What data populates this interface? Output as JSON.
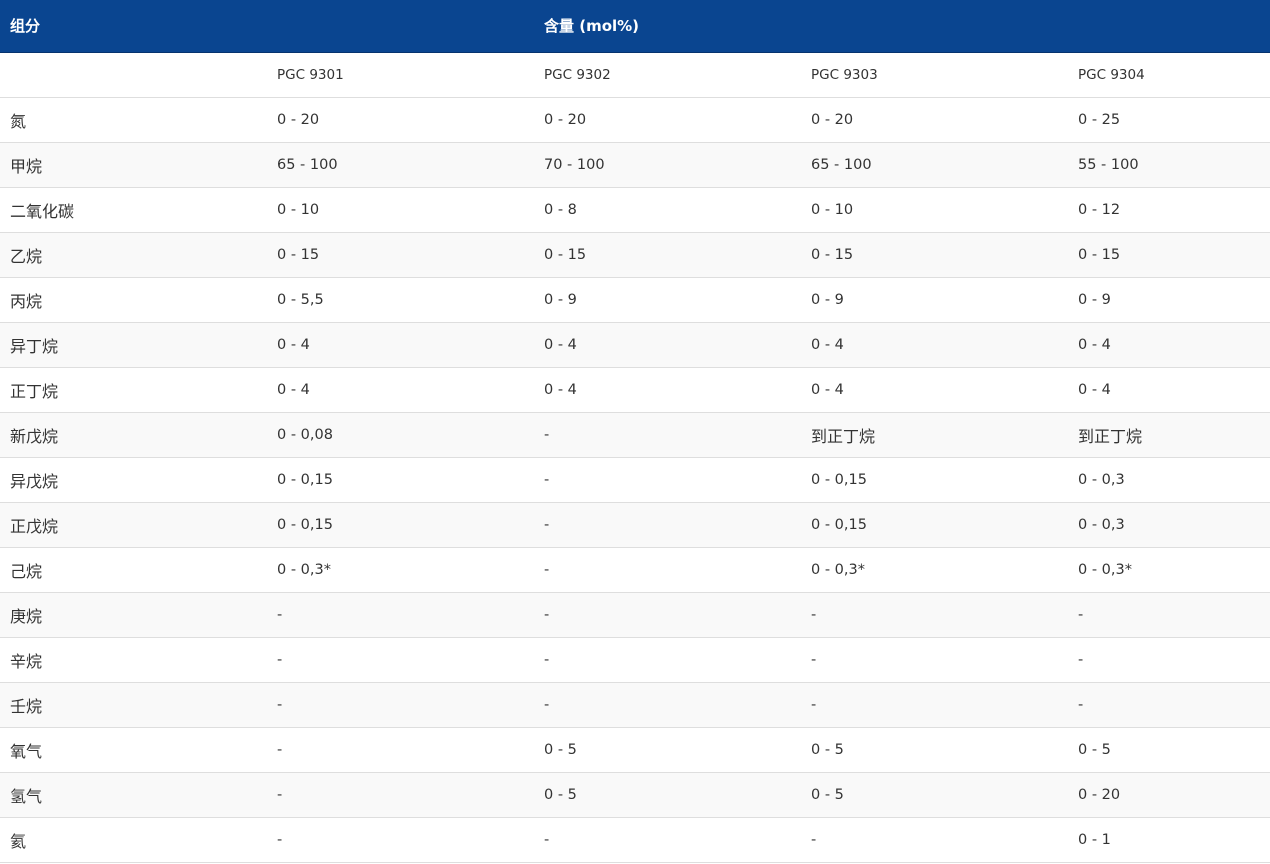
{
  "table": {
    "header": {
      "component_label": "组分",
      "content_label": "含量 (mol%)"
    },
    "models": [
      "PGC 9301",
      "PGC 9302",
      "PGC 9303",
      "PGC 9304"
    ],
    "rows": [
      {
        "component": "氮",
        "values": [
          "0 - 20",
          "0 - 20",
          "0 - 20",
          "0 - 25"
        ]
      },
      {
        "component": "甲烷",
        "values": [
          "65 - 100",
          "70 - 100",
          "65 - 100",
          "55 - 100"
        ]
      },
      {
        "component": "二氧化碳",
        "values": [
          "0 - 10",
          "0 - 8",
          "0 - 10",
          "0 - 12"
        ]
      },
      {
        "component": "乙烷",
        "values": [
          "0 - 15",
          "0 - 15",
          "0 - 15",
          "0 - 15"
        ]
      },
      {
        "component": "丙烷",
        "values": [
          "0 - 5,5",
          "0 - 9",
          "0 - 9",
          "0 - 9"
        ]
      },
      {
        "component": "异丁烷",
        "values": [
          "0 - 4",
          "0 - 4",
          "0 - 4",
          "0 - 4"
        ]
      },
      {
        "component": "正丁烷",
        "values": [
          "0 - 4",
          "0 - 4",
          "0 - 4",
          "0 - 4"
        ]
      },
      {
        "component": "新戊烷",
        "values": [
          "0 - 0,08",
          "-",
          "到正丁烷",
          "到正丁烷"
        ]
      },
      {
        "component": "异戊烷",
        "values": [
          "0 - 0,15",
          "-",
          "0 - 0,15",
          "0 - 0,3"
        ]
      },
      {
        "component": "正戊烷",
        "values": [
          "0 - 0,15",
          "-",
          "0 - 0,15",
          "0 - 0,3"
        ]
      },
      {
        "component": "己烷",
        "values": [
          "0 - 0,3*",
          "-",
          "0 - 0,3*",
          "0 - 0,3*"
        ]
      },
      {
        "component": "庚烷",
        "values": [
          "-",
          "-",
          "-",
          "-"
        ]
      },
      {
        "component": "辛烷",
        "values": [
          "-",
          "-",
          "-",
          "-"
        ]
      },
      {
        "component": "壬烷",
        "values": [
          "-",
          "-",
          "-",
          "-"
        ]
      },
      {
        "component": "氧气",
        "values": [
          "-",
          "0 - 5",
          "0 - 5",
          "0 - 5"
        ]
      },
      {
        "component": "氢气",
        "values": [
          "-",
          "0 - 5",
          "0 - 5",
          "0 - 20"
        ]
      },
      {
        "component": "氦",
        "values": [
          "-",
          "-",
          "-",
          "0 - 1"
        ]
      }
    ]
  }
}
